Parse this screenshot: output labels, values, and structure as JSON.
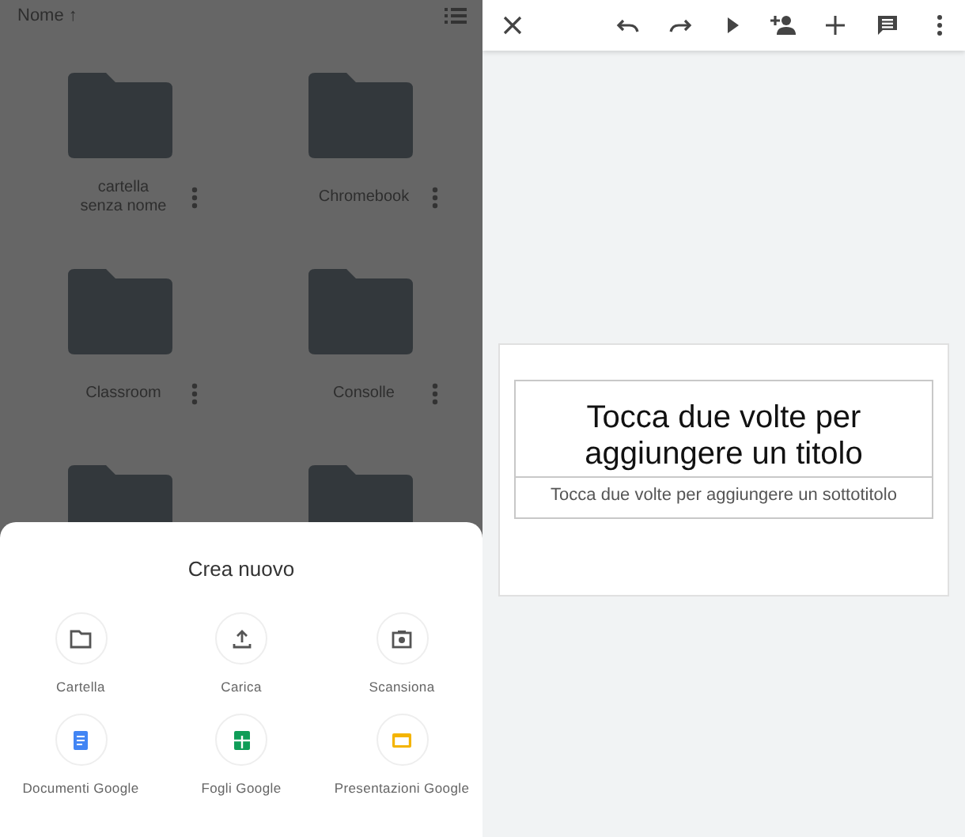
{
  "file_list": {
    "sort_label": "Nome",
    "sort_arrow": "↑",
    "folders": [
      {
        "kind": "folder",
        "name": "cartella\nsenza nome"
      },
      {
        "kind": "folder",
        "name": "Chromebook"
      },
      {
        "kind": "folder",
        "name": "Classroom"
      },
      {
        "kind": "folder",
        "name": "Consolle"
      },
      {
        "kind": "folder"
      },
      {
        "kind": "folder"
      }
    ]
  },
  "create_sheet": {
    "title": "Crea nuovo",
    "actions": [
      {
        "kind": "folder",
        "label": "Cartella"
      },
      {
        "kind": "upload",
        "label": "Carica"
      },
      {
        "kind": "scan",
        "label": "Scansiona"
      },
      {
        "kind": "docs",
        "label": "Documenti Google"
      },
      {
        "kind": "sheets",
        "label": "Fogli Google"
      },
      {
        "kind": "slides",
        "label": "Presentazioni Google"
      }
    ]
  },
  "editor": {
    "toolbar": [
      {
        "kind": "close"
      },
      {
        "kind": "undo"
      },
      {
        "kind": "redo"
      },
      {
        "kind": "play"
      },
      {
        "kind": "add-person"
      },
      {
        "kind": "add"
      },
      {
        "kind": "comment"
      },
      {
        "kind": "more"
      }
    ],
    "slide": {
      "title_placeholder": "Tocca due volte per aggiungere un titolo",
      "subtitle_placeholder": "Tocca due volte per aggiungere un sottotitolo"
    }
  }
}
